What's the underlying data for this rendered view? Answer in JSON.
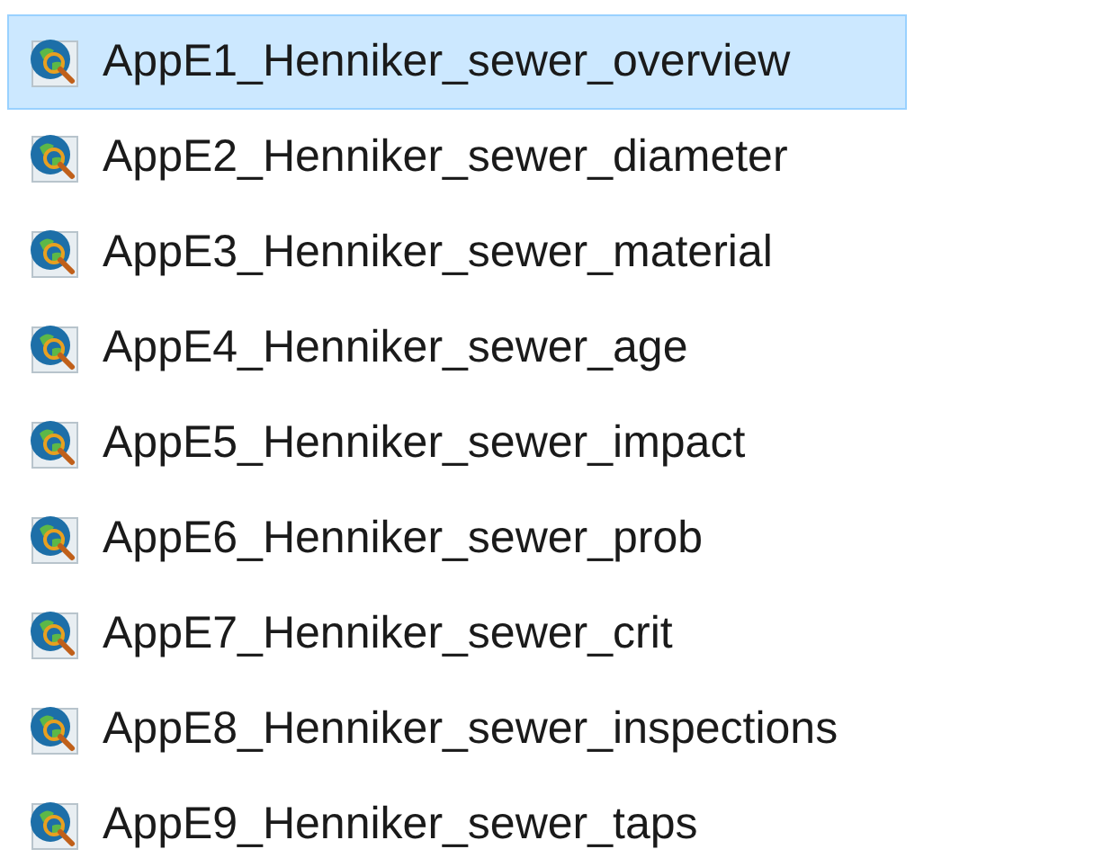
{
  "files": [
    {
      "name": "AppE1_Henniker_sewer_overview",
      "selected": true
    },
    {
      "name": "AppE2_Henniker_sewer_diameter",
      "selected": false
    },
    {
      "name": "AppE3_Henniker_sewer_material",
      "selected": false
    },
    {
      "name": "AppE4_Henniker_sewer_age",
      "selected": false
    },
    {
      "name": "AppE5_Henniker_sewer_impact",
      "selected": false
    },
    {
      "name": "AppE6_Henniker_sewer_prob",
      "selected": false
    },
    {
      "name": "AppE7_Henniker_sewer_crit",
      "selected": false
    },
    {
      "name": "AppE8_Henniker_sewer_inspections",
      "selected": false
    },
    {
      "name": "AppE9_Henniker_sewer_taps",
      "selected": false
    }
  ]
}
